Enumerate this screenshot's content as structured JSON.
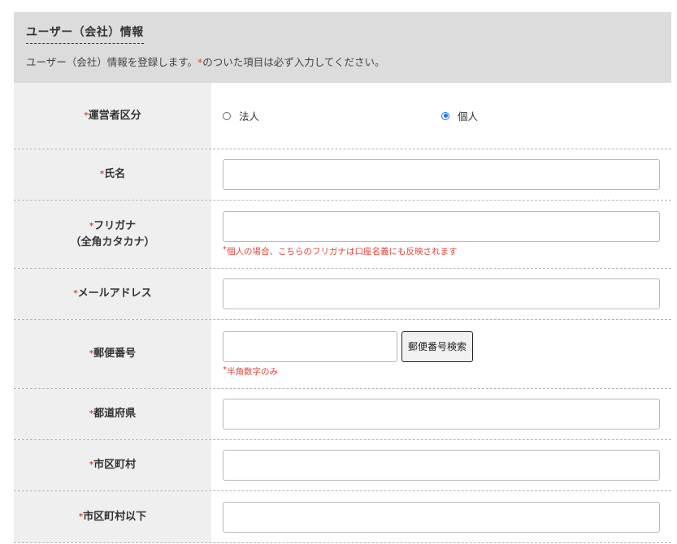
{
  "section": {
    "title": "ユーザー（会社）情報",
    "desc_before": "ユーザー（会社）情報を登録します。",
    "required_mark": "*",
    "desc_after": "のついた項目は必ず入力してください。"
  },
  "fields": {
    "operator_type": {
      "label": "運営者区分",
      "options": [
        {
          "label": "法人",
          "selected": false
        },
        {
          "label": "個人",
          "selected": true
        }
      ]
    },
    "name": {
      "label": "氏名",
      "value": ""
    },
    "furigana": {
      "label": "フリガナ",
      "label_sub": "（全角カタカナ）",
      "value": "",
      "note": "個人の場合、こちらのフリガナは口座名義にも反映されます"
    },
    "email": {
      "label": "メールアドレス",
      "value": ""
    },
    "zip": {
      "label": "郵便番号",
      "value": "",
      "button": "郵便番号検索",
      "note": "半角数字のみ"
    },
    "prefecture": {
      "label": "都道府県",
      "value": ""
    },
    "city": {
      "label": "市区町村",
      "value": ""
    },
    "address": {
      "label": "市区町村以下",
      "value": ""
    }
  },
  "colors": {
    "required": "#e0433a",
    "header_bg": "#dcdcdc",
    "label_bg": "#efefef",
    "radio_accent": "#1a73e8"
  }
}
